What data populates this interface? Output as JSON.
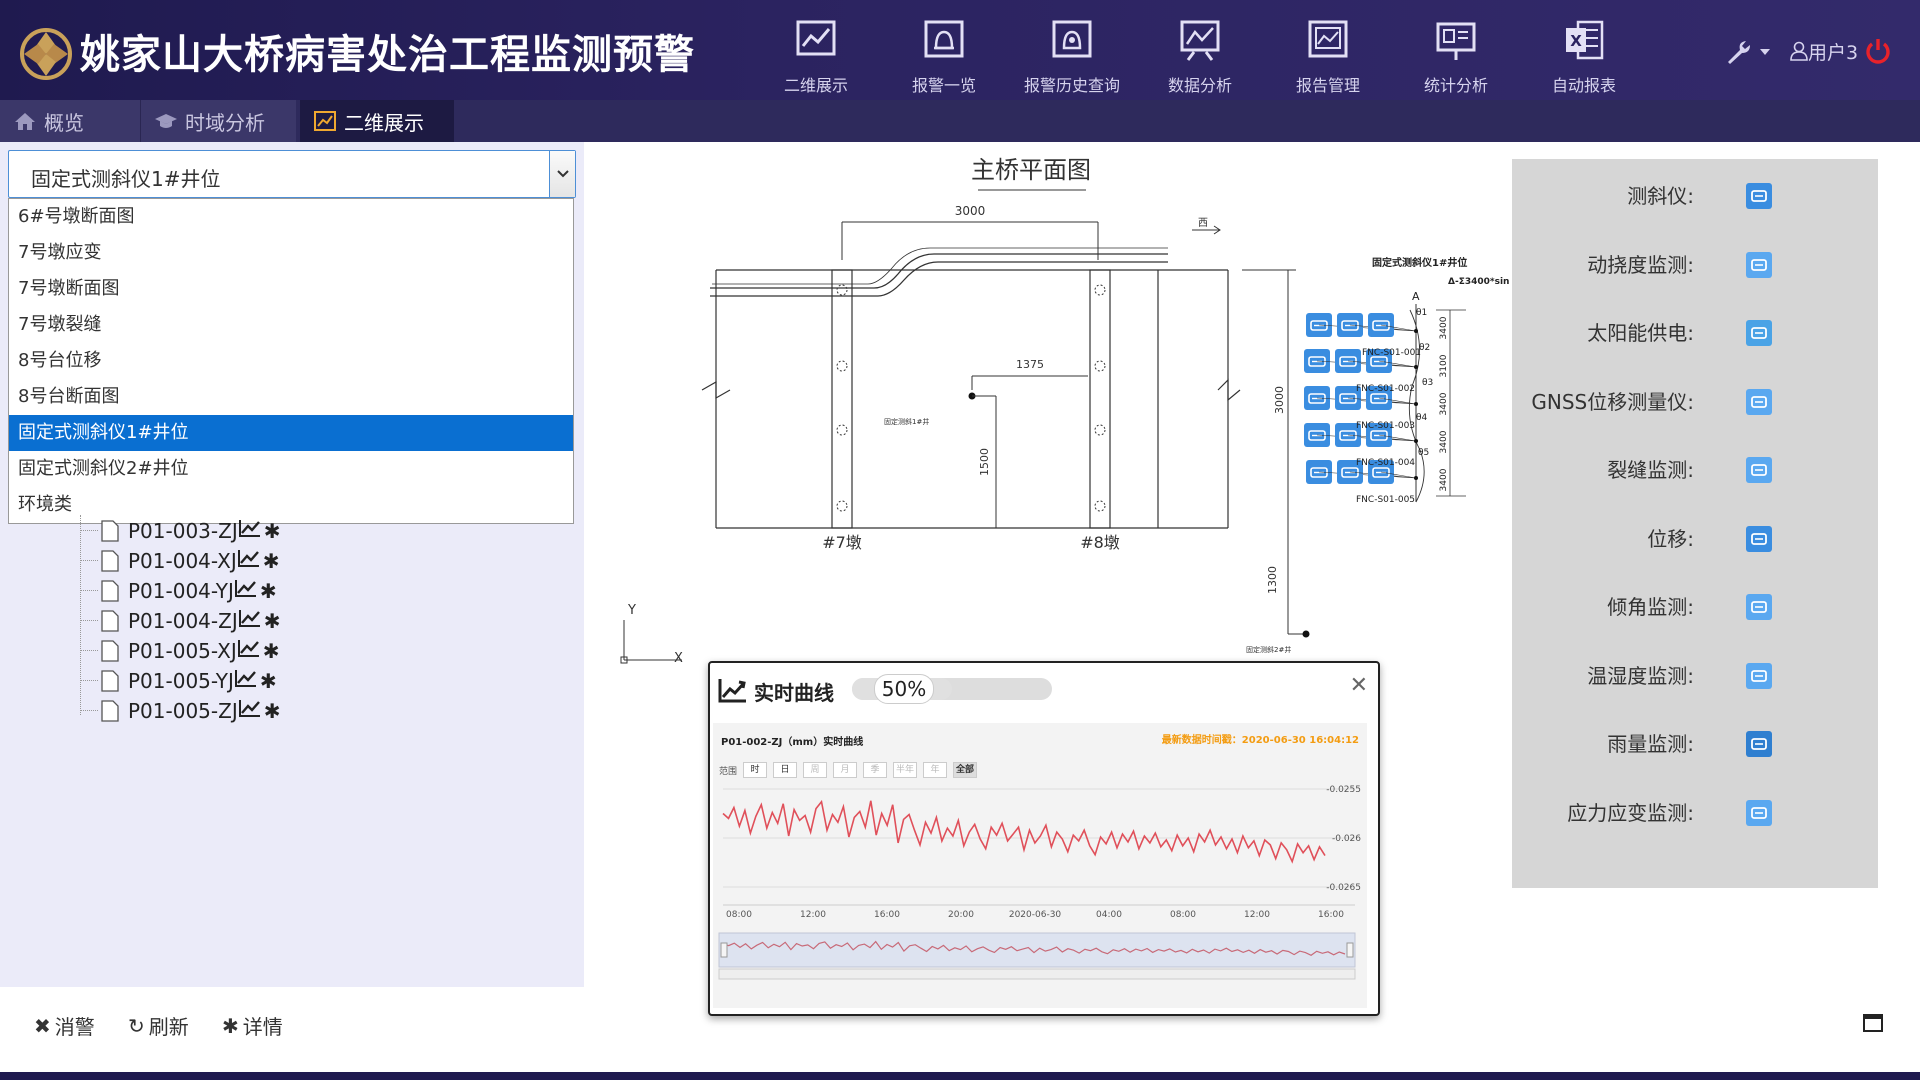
{
  "header": {
    "title": "姚家山大桥病害处治工程监测预警",
    "nav": [
      {
        "label": "二维展示",
        "icon": "chart-board-icon"
      },
      {
        "label": "报警一览",
        "icon": "alarm-icon"
      },
      {
        "label": "报警历史查询",
        "icon": "alarm-history-icon"
      },
      {
        "label": "数据分析",
        "icon": "data-analysis-icon"
      },
      {
        "label": "报告管理",
        "icon": "report-icon"
      },
      {
        "label": "统计分析",
        "icon": "statistics-icon"
      },
      {
        "label": "自动报表",
        "icon": "excel-icon"
      }
    ],
    "user": "用户3"
  },
  "tabs": [
    {
      "label": "概览"
    },
    {
      "label": "时域分析"
    },
    {
      "label": "二维展示"
    }
  ],
  "select": {
    "value": "固定式测斜仪1#井位",
    "options": [
      "6#号墩断面图",
      "7号墩应变",
      "7号墩断面图",
      "7号墩裂缝",
      "8号台位移",
      "8号台断面图",
      "固定式测斜仪1#井位",
      "固定式测斜仪2#井位",
      "环境类"
    ]
  },
  "tree": [
    {
      "label": "P01-003-ZJ"
    },
    {
      "label": "P01-004-XJ"
    },
    {
      "label": "P01-004-YJ"
    },
    {
      "label": "P01-004-ZJ"
    },
    {
      "label": "P01-005-XJ"
    },
    {
      "label": "P01-005-YJ"
    },
    {
      "label": "P01-005-ZJ"
    }
  ],
  "toolbar": {
    "dismiss": "消警",
    "refresh": "刷新",
    "details": "详情"
  },
  "drawing": {
    "title": "主桥平面图",
    "dims": {
      "top": "3000",
      "mid": "1375",
      "v1500": "1500",
      "right3000": "3000",
      "v1300": "1300"
    },
    "piers": {
      "p7": "#7墩",
      "p8": "#8墩"
    },
    "north": "西",
    "section_label": "固定式测斜仪1#井位",
    "formula": "Δ-Σ3400*sin",
    "axis_a": "A",
    "theta": [
      "θ1",
      "θ2",
      "θ3",
      "θ4",
      "θ5"
    ],
    "right_dims": [
      "3400",
      "3100",
      "3400",
      "3400",
      "3400"
    ],
    "sensors": [
      "FNC-S01-001",
      "FNC-S01-002",
      "FNC-S01-003",
      "FNC-S01-004",
      "FNC-S01-005"
    ],
    "well1_label": "固定测斜1#井",
    "well2_label": "固定测斜2#井",
    "axis_y": "Y",
    "axis_x": "X"
  },
  "legend": [
    {
      "label": "测斜仪:",
      "icon": "inclinometer-icon",
      "color": "#3a8de0"
    },
    {
      "label": "动挠度监测:",
      "icon": "deflection-icon",
      "color": "#5aa8f0"
    },
    {
      "label": "太阳能供电:",
      "icon": "solar-power-icon",
      "color": "#4aa3e6"
    },
    {
      "label": "GNSS位移测量仪:",
      "icon": "gnss-icon",
      "color": "#5aa8f0"
    },
    {
      "label": "裂缝监测:",
      "icon": "crack-icon",
      "color": "#5aa8f0"
    },
    {
      "label": "位移:",
      "icon": "displacement-icon",
      "color": "#3a8de0"
    },
    {
      "label": "倾角监测:",
      "icon": "tilt-icon",
      "color": "#5aa8f0"
    },
    {
      "label": "温湿度监测:",
      "icon": "temp-humidity-icon",
      "color": "#5aa8f0"
    },
    {
      "label": "雨量监测:",
      "icon": "rain-icon",
      "color": "#2f7fd0"
    },
    {
      "label": "应力应变监测:",
      "icon": "strain-icon",
      "color": "#5aa8f0"
    }
  ],
  "popup": {
    "title": "实时曲线",
    "progress_label": "50%",
    "progress_value": 0.5,
    "chart_title": "P01-002-ZJ（mm）实时曲线",
    "updated": "最新数据时间戳：2020-06-30 16:04:12",
    "range_label": "范围",
    "ranges": [
      "时",
      "日",
      "周",
      "月",
      "季",
      "半年",
      "年",
      "全部"
    ]
  },
  "chart_data": {
    "type": "line",
    "title": "P01-002-ZJ（mm）实时曲线",
    "x_ticks": [
      "08:00",
      "12:00",
      "16:00",
      "20:00",
      "2020-06-30",
      "04:00",
      "08:00",
      "12:00",
      "16:00"
    ],
    "y_ticks": [
      "-0.0255",
      "-0.026",
      "-0.0265"
    ],
    "ylim": [
      -0.0265,
      -0.0255
    ],
    "series": [
      {
        "values": [
          -0.02575,
          -0.0258,
          -0.02569,
          -0.02588,
          -0.02572,
          -0.02595,
          -0.02578,
          -0.02566,
          -0.0259,
          -0.02574,
          -0.02585,
          -0.02565,
          -0.02598,
          -0.02571,
          -0.02582,
          -0.02577,
          -0.02594,
          -0.0257,
          -0.02563,
          -0.02592,
          -0.02576,
          -0.02584,
          -0.02568,
          -0.02599,
          -0.02579,
          -0.02573,
          -0.02589,
          -0.02562,
          -0.02597,
          -0.02575,
          -0.02587,
          -0.02566,
          -0.02605,
          -0.02581,
          -0.02576,
          -0.02592,
          -0.02607,
          -0.02584,
          -0.02595,
          -0.02579,
          -0.02603,
          -0.0259,
          -0.02598,
          -0.02582,
          -0.02608,
          -0.02594,
          -0.02586,
          -0.02601,
          -0.02611,
          -0.02589,
          -0.02597,
          -0.02585,
          -0.02603,
          -0.02596,
          -0.02589,
          -0.02612,
          -0.02592,
          -0.02605,
          -0.02598,
          -0.02587,
          -0.02609,
          -0.02594,
          -0.02601,
          -0.02614,
          -0.02597,
          -0.02603,
          -0.02592,
          -0.02608,
          -0.02617,
          -0.02599,
          -0.02606,
          -0.02594,
          -0.0261,
          -0.02596,
          -0.02604,
          -0.02593,
          -0.02611,
          -0.02598,
          -0.02605,
          -0.02595,
          -0.02609,
          -0.02602,
          -0.02613,
          -0.02597,
          -0.02608,
          -0.026,
          -0.02614,
          -0.02596,
          -0.02604,
          -0.02592,
          -0.02607,
          -0.02599,
          -0.02611,
          -0.02601,
          -0.02615,
          -0.02598,
          -0.0261,
          -0.02603,
          -0.02618,
          -0.02602,
          -0.02607,
          -0.02621,
          -0.02605,
          -0.02612,
          -0.02624,
          -0.02606,
          -0.02615,
          -0.02608,
          -0.02622,
          -0.02609,
          -0.02618
        ]
      }
    ],
    "grid": true
  }
}
